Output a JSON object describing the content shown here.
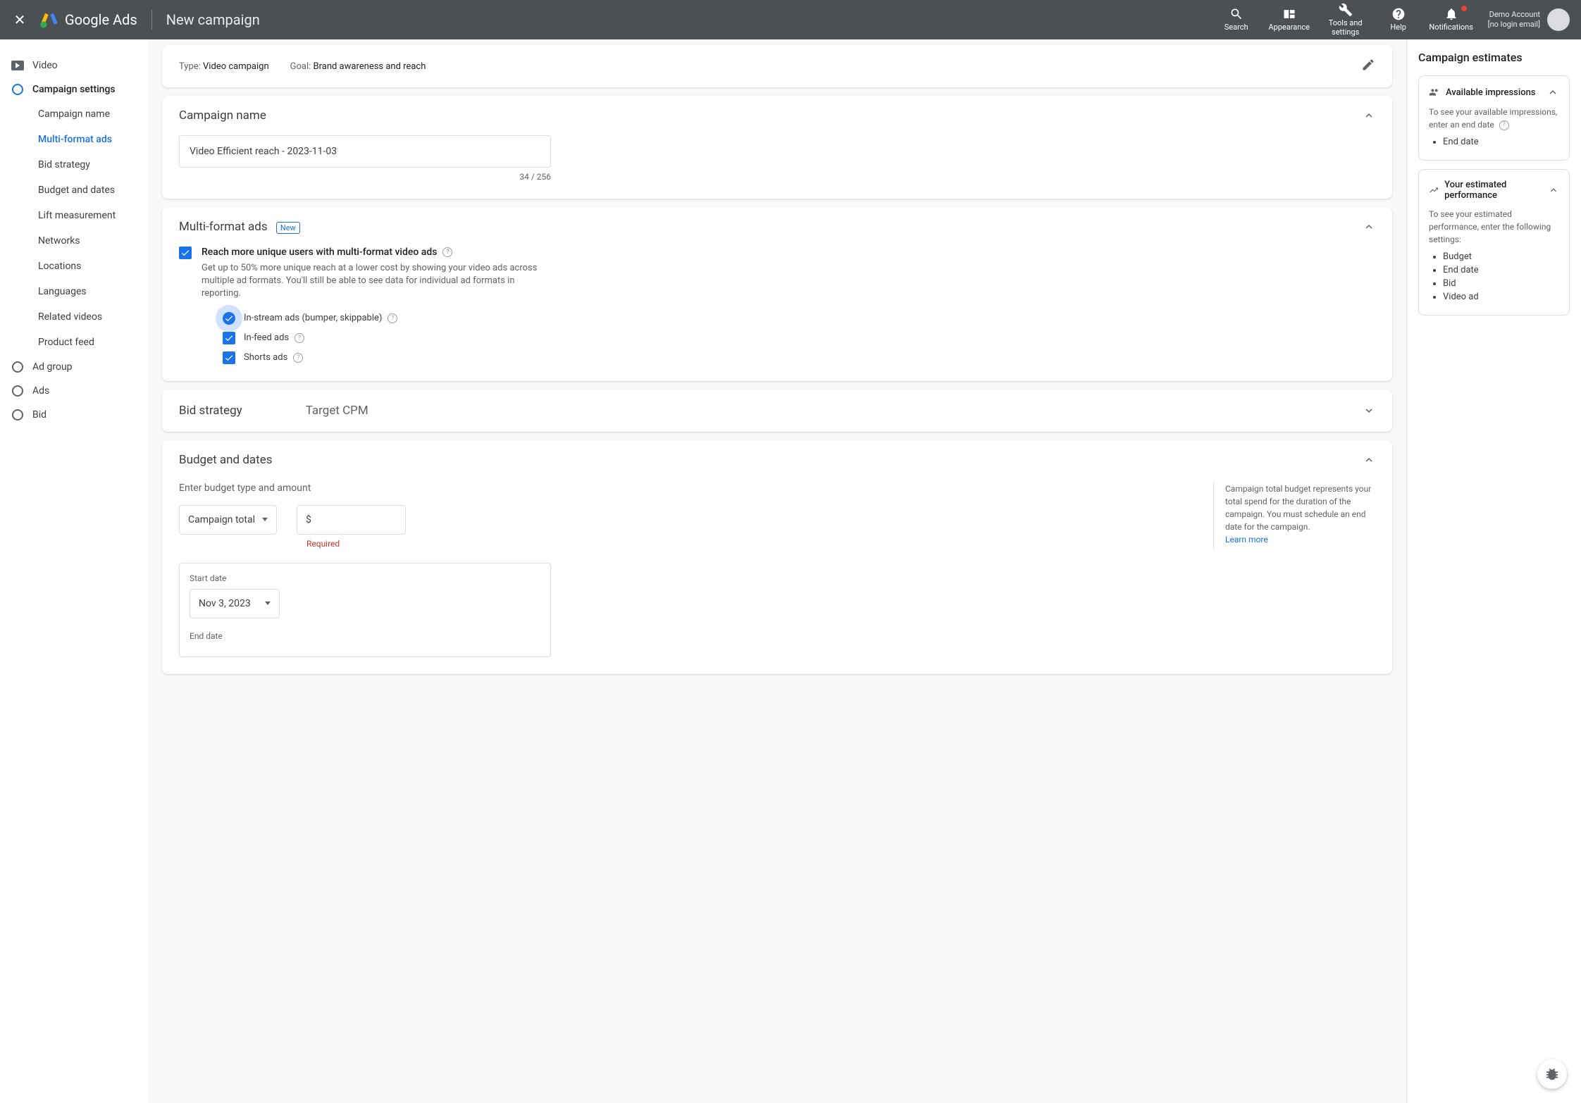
{
  "header": {
    "logo_text": "Google Ads",
    "page_title": "New campaign",
    "tools": {
      "search": "Search",
      "appearance": "Appearance",
      "tools": "Tools and settings",
      "help": "Help",
      "notifications": "Notifications"
    },
    "account": {
      "name": "Demo Account",
      "email": "[no login email]"
    }
  },
  "sidebar": {
    "video": "Video",
    "campaign_settings": "Campaign settings",
    "subs": {
      "campaign_name": "Campaign name",
      "multi_format": "Multi-format ads",
      "bid_strategy": "Bid strategy",
      "budget_dates": "Budget and dates",
      "lift": "Lift measurement",
      "networks": "Networks",
      "locations": "Locations",
      "languages": "Languages",
      "related": "Related videos",
      "product_feed": "Product feed"
    },
    "ad_group": "Ad group",
    "ads": "Ads",
    "bid": "Bid"
  },
  "summary": {
    "type_label": "Type: ",
    "type_value": "Video campaign",
    "goal_label": "Goal: ",
    "goal_value": "Brand awareness and reach"
  },
  "campaign_name": {
    "title": "Campaign name",
    "value": "Video Efficient reach - 2023-11-03",
    "counter": "34 / 256"
  },
  "multi_format": {
    "title": "Multi-format ads",
    "badge": "New",
    "main_label": "Reach more unique users with multi-format video ads",
    "desc": "Get up to 50% more unique reach at a lower cost by showing your video ads across multiple ad formats. You'll still be able to see data for individual ad formats in reporting.",
    "instream": "In-stream ads (bumper, skippable)",
    "infeed": "In-feed ads",
    "shorts": "Shorts ads"
  },
  "bid_strategy": {
    "title": "Bid strategy",
    "value": "Target CPM"
  },
  "budget": {
    "title": "Budget and dates",
    "prompt": "Enter budget type and amount",
    "type_value": "Campaign total",
    "currency": "$",
    "required": "Required",
    "info": "Campaign total budget represents your total spend for the duration of the campaign. You must schedule an end date for the campaign.",
    "learn": "Learn more",
    "start_label": "Start date",
    "start_value": "Nov 3, 2023",
    "end_label": "End date"
  },
  "estimates": {
    "title": "Campaign estimates",
    "impressions": {
      "title": "Available impressions",
      "text": "To see your available impressions, enter an end date",
      "item1": "End date"
    },
    "performance": {
      "title": "Your estimated performance",
      "text": "To see your estimated performance, enter the following settings:",
      "item1": "Budget",
      "item2": "End date",
      "item3": "Bid",
      "item4": "Video ad"
    }
  }
}
